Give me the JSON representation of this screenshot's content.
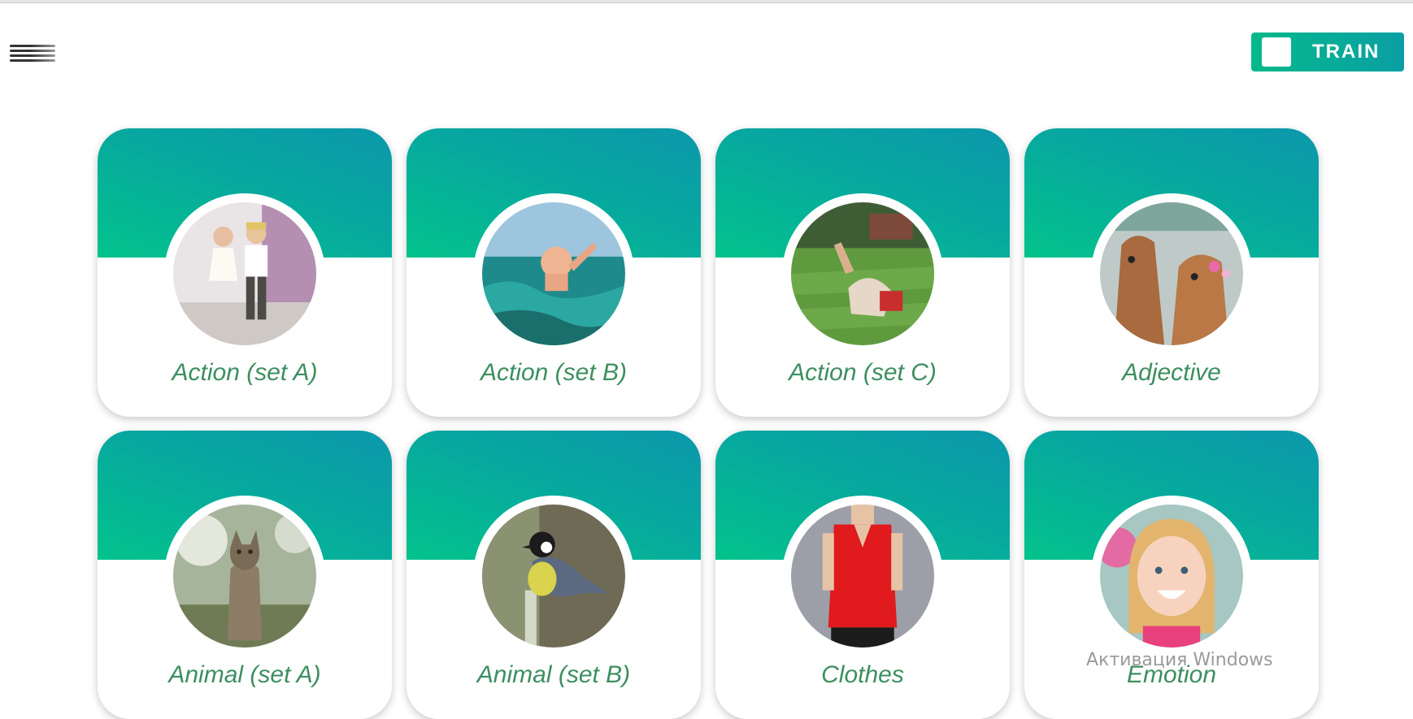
{
  "header": {
    "menu_icon": "hamburger-menu-icon",
    "train_toggle": {
      "label": "TRAIN",
      "on": false
    }
  },
  "categories": [
    {
      "title": "Action (set A)",
      "image": "children-dancing-photo"
    },
    {
      "title": "Action (set B)",
      "image": "child-swimming-photo"
    },
    {
      "title": "Action (set C)",
      "image": "man-somersault-photo"
    },
    {
      "title": "Adjective",
      "image": "capybaras-photo"
    },
    {
      "title": "Animal (set A)",
      "image": "cat-photo"
    },
    {
      "title": "Animal (set B)",
      "image": "bird-photo"
    },
    {
      "title": "Clothes",
      "image": "red-blouse-photo"
    },
    {
      "title": "Emotion",
      "image": "smiling-girl-photo"
    }
  ],
  "watermark": "Активация Windows",
  "colors": {
    "accent_start": "#03c38c",
    "accent_end": "#0c98ab",
    "title_text": "#3c8f5f"
  }
}
